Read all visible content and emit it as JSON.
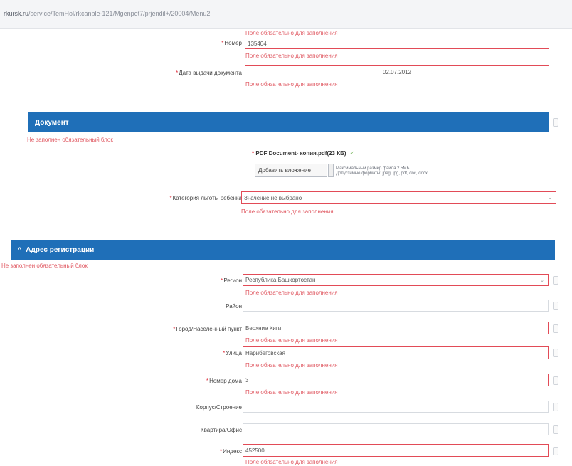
{
  "browser": {
    "url_host": "rkursk.ru",
    "url_path": "/service/TemHol/rkcanble-121/Mgenpet7/prjendil+/20004/Menu2"
  },
  "errors": {
    "required_field": "Поле обязательно для заполнения",
    "block_not_filled": "Не заполнен обязательный блок"
  },
  "fields_top": {
    "number_label": "Номер",
    "number_value": "135404",
    "issue_date_label": "Дата выдачи документа",
    "issue_date_value": "02.07.2012"
  },
  "document_section": {
    "title": "Документ",
    "file_name": "PDF Document- копия.pdf(23 КБ)",
    "attach_button": "Добавить вложение",
    "note_line1": "Максимальный размер файла 2.5МБ",
    "note_line2": "Допустимые форматы: jpeg, jpg, pdf, doc, docx",
    "category_label": "Категория льготы ребенка",
    "category_value": "Значение не выбрано"
  },
  "address_section": {
    "title": "Адрес регистрации",
    "region_label": "Регион",
    "region_value": "Республика Башкортостан",
    "district_label": "Район",
    "district_value": "",
    "city_label": "Город/Населенный пункт",
    "city_value": "Верхние Киги",
    "street_label": "Улица",
    "street_value": "Нарибеговская",
    "house_label": "Номер дома",
    "house_value": "3",
    "building_label": "Корпус/Строение",
    "building_value": "",
    "apartment_label": "Квартира/Офис",
    "apartment_value": "",
    "index_label": "Индекс",
    "index_value": "452500"
  },
  "colors": {
    "band_blue": "#1f6fb8",
    "error_red": "#e05a63"
  }
}
